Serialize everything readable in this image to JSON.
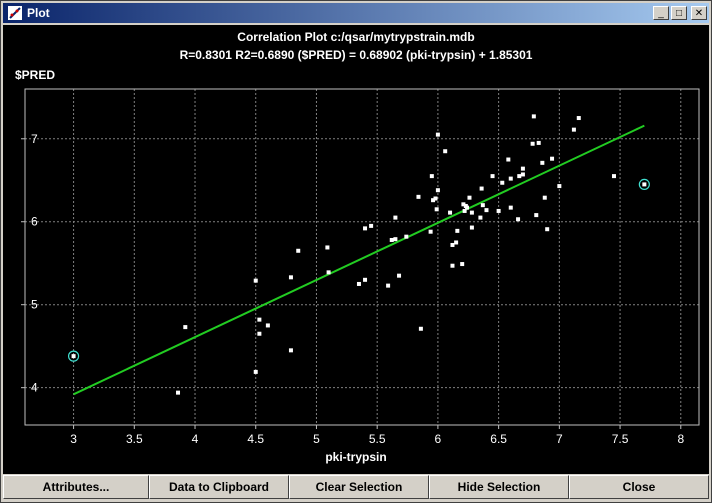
{
  "window": {
    "title": "Plot"
  },
  "titlebar_buttons": {
    "minimize": "_",
    "maximize": "□",
    "close": "✕"
  },
  "buttons": {
    "attributes": "Attributes...",
    "clipboard": "Data to Clipboard",
    "clear_selection": "Clear Selection",
    "hide_selection": "Hide Selection",
    "close": "Close"
  },
  "colors": {
    "background": "#000000",
    "points": "#ffffff",
    "fit_line": "#22cc22",
    "selected": "#40e0d0",
    "grid": "#808080"
  },
  "chart_data": {
    "type": "scatter",
    "title": "Correlation Plot c:/qsar/mytrypstrain.mdb",
    "subtitle": "R=0.8301 R2=0.6890    ($PRED) = 0.68902 (pki-trypsin) + 1.85301",
    "xlabel": "pki-trypsin",
    "ylabel": "$PRED",
    "xlim": [
      2.6,
      8.15
    ],
    "ylim": [
      3.55,
      7.6
    ],
    "xticks": [
      "3",
      "3.5",
      "4",
      "4.5",
      "5",
      "5.5",
      "6",
      "6.5",
      "7",
      "7.5",
      "8"
    ],
    "yticks": [
      "4",
      "5",
      "6",
      "7"
    ],
    "grid": true,
    "fit_line": {
      "slope": 0.68902,
      "intercept": 1.85301,
      "x_range": [
        3.0,
        7.7
      ]
    },
    "points": [
      [
        3.86,
        3.94
      ],
      [
        3.92,
        4.73
      ],
      [
        4.5,
        4.19
      ],
      [
        4.5,
        5.29
      ],
      [
        4.53,
        4.82
      ],
      [
        4.53,
        4.65
      ],
      [
        4.6,
        4.75
      ],
      [
        4.79,
        4.45
      ],
      [
        4.79,
        5.33
      ],
      [
        4.85,
        5.65
      ],
      [
        5.09,
        5.69
      ],
      [
        5.1,
        5.39
      ],
      [
        5.35,
        5.25
      ],
      [
        5.4,
        5.3
      ],
      [
        5.4,
        5.92
      ],
      [
        5.45,
        5.95
      ],
      [
        5.59,
        5.23
      ],
      [
        5.62,
        5.78
      ],
      [
        5.65,
        5.79
      ],
      [
        5.65,
        6.05
      ],
      [
        5.68,
        5.35
      ],
      [
        5.74,
        5.82
      ],
      [
        5.84,
        6.3
      ],
      [
        5.86,
        4.71
      ],
      [
        5.94,
        5.88
      ],
      [
        5.95,
        6.55
      ],
      [
        5.96,
        6.26
      ],
      [
        5.98,
        6.28
      ],
      [
        5.99,
        6.15
      ],
      [
        6.0,
        6.38
      ],
      [
        6.0,
        7.05
      ],
      [
        6.06,
        6.85
      ],
      [
        6.1,
        6.11
      ],
      [
        6.12,
        5.47
      ],
      [
        6.12,
        5.72
      ],
      [
        6.15,
        5.75
      ],
      [
        6.16,
        5.89
      ],
      [
        6.2,
        5.49
      ],
      [
        6.21,
        6.21
      ],
      [
        6.22,
        6.13
      ],
      [
        6.23,
        6.19
      ],
      [
        6.24,
        6.17
      ],
      [
        6.26,
        6.29
      ],
      [
        6.28,
        6.11
      ],
      [
        6.28,
        5.93
      ],
      [
        6.35,
        6.05
      ],
      [
        6.36,
        6.4
      ],
      [
        6.37,
        6.2
      ],
      [
        6.4,
        6.14
      ],
      [
        6.45,
        6.55
      ],
      [
        6.5,
        6.13
      ],
      [
        6.53,
        6.47
      ],
      [
        6.58,
        6.75
      ],
      [
        6.6,
        6.17
      ],
      [
        6.6,
        6.52
      ],
      [
        6.66,
        6.03
      ],
      [
        6.67,
        6.55
      ],
      [
        6.7,
        6.57
      ],
      [
        6.7,
        6.64
      ],
      [
        6.78,
        6.94
      ],
      [
        6.79,
        7.27
      ],
      [
        6.81,
        6.08
      ],
      [
        6.83,
        6.95
      ],
      [
        6.86,
        6.71
      ],
      [
        6.88,
        6.29
      ],
      [
        6.9,
        5.91
      ],
      [
        6.94,
        6.76
      ],
      [
        7.0,
        6.43
      ],
      [
        7.12,
        7.11
      ],
      [
        7.16,
        7.25
      ],
      [
        7.45,
        6.55
      ]
    ],
    "selected_points": [
      [
        3.0,
        4.38
      ],
      [
        7.7,
        6.45
      ]
    ]
  }
}
